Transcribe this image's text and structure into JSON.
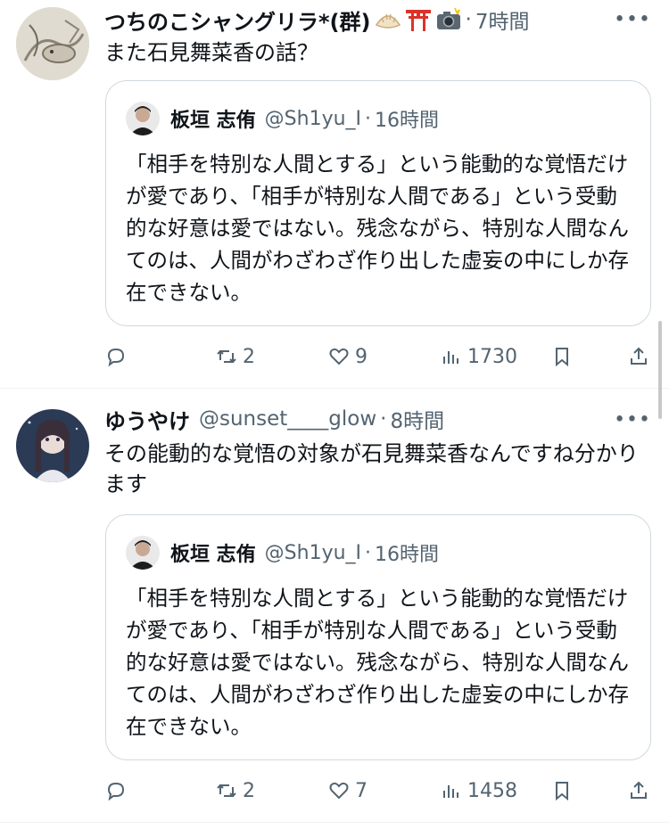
{
  "tweets": [
    {
      "author_name": "つちのこシャングリラ*(群)",
      "emojis": [
        "dumpling-icon",
        "torii-icon",
        "camera-flash-icon"
      ],
      "time": "7時間",
      "separator": "·",
      "text": "また石見舞菜香の話？",
      "quote": {
        "author_name": "板垣 志侑",
        "handle": "@Sh1yu_I",
        "time": "16時間",
        "text": "「相手を特別な人間とする」という能動的な覚悟だけが愛であり、「相手が特別な人間である」という受動的な好意は愛ではない。残念ながら、特別な人間なんてのは、人間がわざわざ作り出した虚妄の中にしか存在できない。"
      },
      "stats": {
        "reposts": "2",
        "likes": "9",
        "views": "1730"
      }
    },
    {
      "author_name": "ゆうやけ",
      "handle": "@sunset____glow",
      "time": "8時間",
      "separator": "·",
      "text": "その能動的な覚悟の対象が石見舞菜香なんですね分かります",
      "quote": {
        "author_name": "板垣 志侑",
        "handle": "@Sh1yu_I",
        "time": "16時間",
        "text": "「相手を特別な人間とする」という能動的な覚悟だけが愛であり、「相手が特別な人間である」という受動的な好意は愛ではない。残念ながら、特別な人間なんてのは、人間がわざわざ作り出した虚妄の中にしか存在できない。"
      },
      "stats": {
        "reposts": "2",
        "likes": "7",
        "views": "1458"
      }
    }
  ],
  "more_label": "•••",
  "colors": {
    "secondary_text": "#536471",
    "border": "#cfd9de",
    "divider": "#eff3f4"
  }
}
